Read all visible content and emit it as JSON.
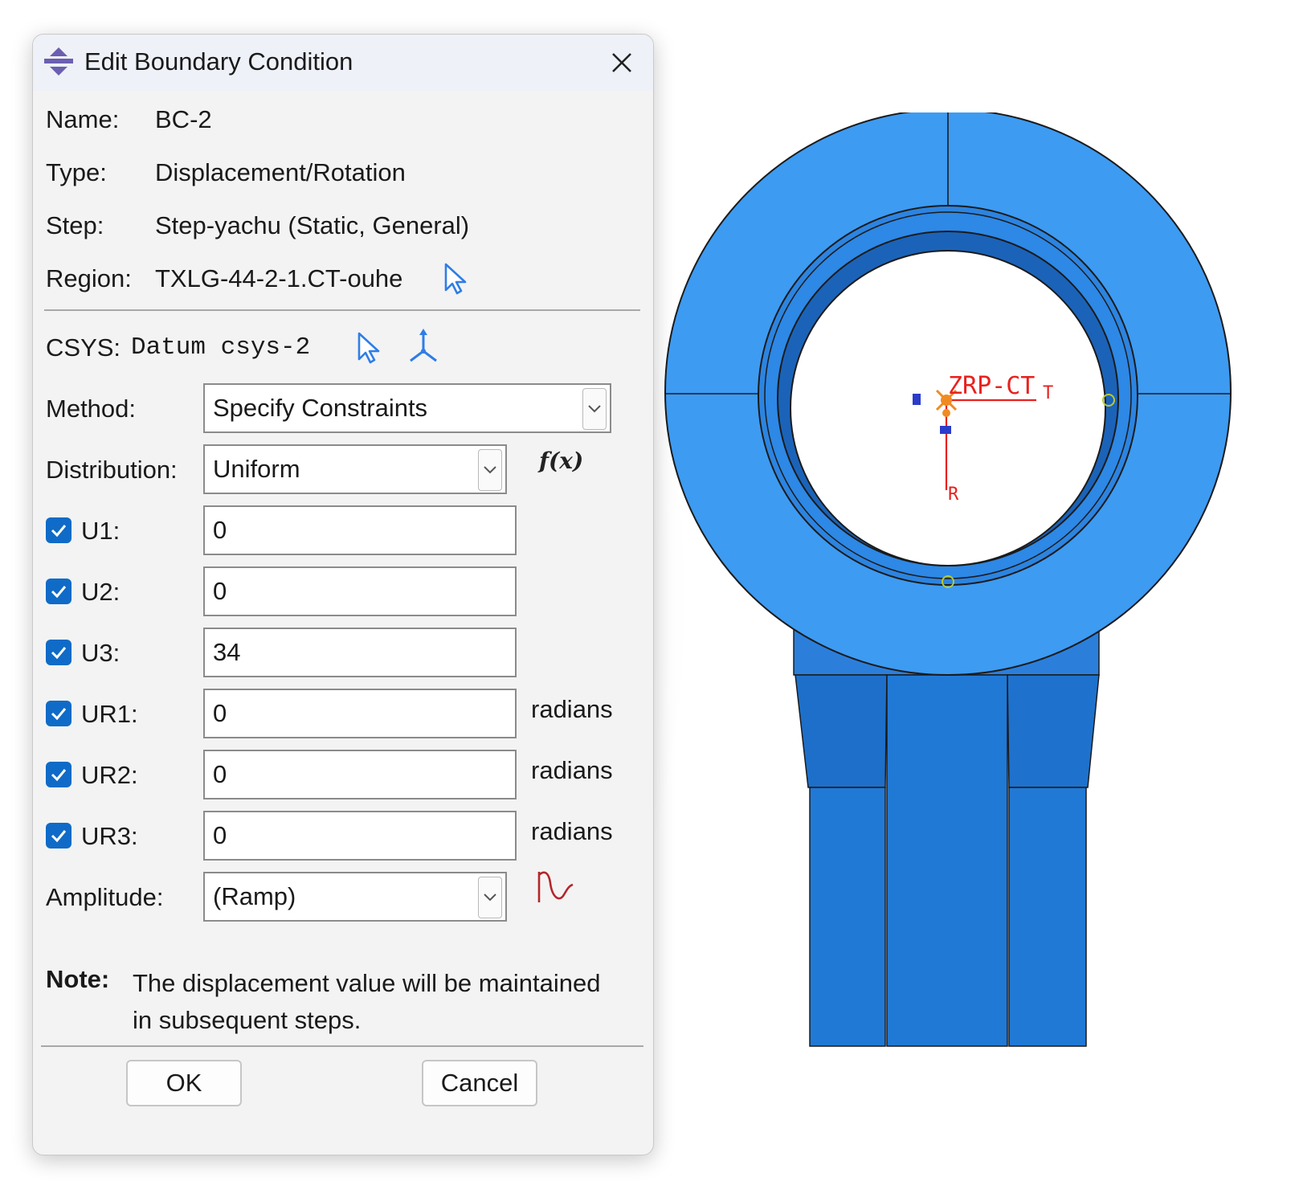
{
  "dialog": {
    "title": "Edit Boundary Condition",
    "name_label": "Name:",
    "name_value": "BC-2",
    "type_label": "Type:",
    "type_value": "Displacement/Rotation",
    "step_label": "Step:",
    "step_value": "Step-yachu (Static, General)",
    "region_label": "Region:",
    "region_value": "TXLG-44-2-1.CT-ouhe",
    "csys_label": "CSYS:",
    "csys_value": "Datum csys-2",
    "method_label": "Method:",
    "method_value": "Specify Constraints",
    "distribution_label": "Distribution:",
    "distribution_value": "Uniform",
    "fx_label": "f(x)",
    "dofs": [
      {
        "label": "U1:",
        "value": "0",
        "checked": true,
        "unit": ""
      },
      {
        "label": "U2:",
        "value": "0",
        "checked": true,
        "unit": ""
      },
      {
        "label": "U3:",
        "value": "34",
        "checked": true,
        "unit": ""
      },
      {
        "label": "UR1:",
        "value": "0",
        "checked": true,
        "unit": "radians"
      },
      {
        "label": "UR2:",
        "value": "0",
        "checked": true,
        "unit": "radians"
      },
      {
        "label": "UR3:",
        "value": "0",
        "checked": true,
        "unit": "radians"
      }
    ],
    "amplitude_label": "Amplitude:",
    "amplitude_value": "(Ramp)",
    "note_key": "Note:",
    "note_text": "The displacement value will be maintained in subsequent steps.",
    "ok_label": "OK",
    "cancel_label": "Cancel"
  },
  "viewport": {
    "rp_label": "ZRP-CT",
    "axis_t_label": "T",
    "axis_r_label": "R",
    "part_color": "#3d9bf2",
    "part_dark_color": "#1d74d4",
    "marker_color": "#e8211e"
  },
  "colors": {
    "accent": "#0f6bc7",
    "select_icon": "#2f7de6"
  }
}
